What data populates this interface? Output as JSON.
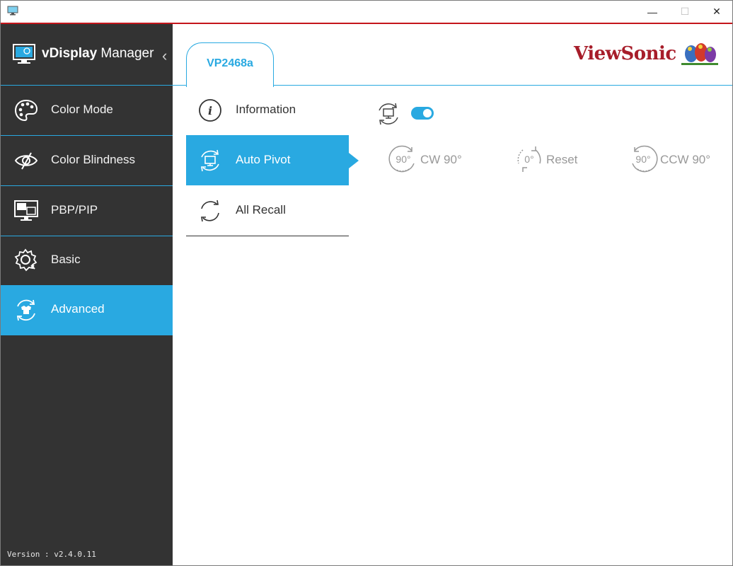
{
  "window": {
    "minimize_glyph": "—",
    "maximize_glyph": "☐",
    "close_glyph": "✕"
  },
  "sidebar": {
    "brand_bold": "vDisplay",
    "brand_regular": " Manager",
    "collapse_glyph": "‹",
    "items": [
      {
        "label": "Color Mode",
        "icon": "palette-icon"
      },
      {
        "label": "Color Blindness",
        "icon": "eye-icon"
      },
      {
        "label": "PBP/PIP",
        "icon": "pip-monitor-icon"
      },
      {
        "label": "Basic",
        "icon": "gear-icon"
      },
      {
        "label": "Advanced",
        "icon": "advanced-icon",
        "active": true
      }
    ],
    "version": "Version : v2.4.0.11"
  },
  "main": {
    "tab_label": "VP2468a",
    "logo_text": "ViewSonic",
    "submenu": [
      {
        "label": "Information",
        "icon": "info-icon"
      },
      {
        "label": "Auto Pivot",
        "icon": "auto-pivot-icon",
        "active": true
      },
      {
        "label": "All Recall",
        "icon": "recall-icon"
      }
    ],
    "auto_pivot": {
      "enabled": true,
      "buttons": [
        {
          "icon_text": "90°",
          "label": "CW 90°"
        },
        {
          "icon_text": "0°",
          "label": "Reset"
        },
        {
          "icon_text": "90°",
          "label": "CCW 90°"
        }
      ]
    }
  },
  "colors": {
    "accent": "#29a9e1",
    "sidebar_bg": "#333333",
    "title_accent": "#c4161c",
    "brand_red": "#a71d2a"
  }
}
